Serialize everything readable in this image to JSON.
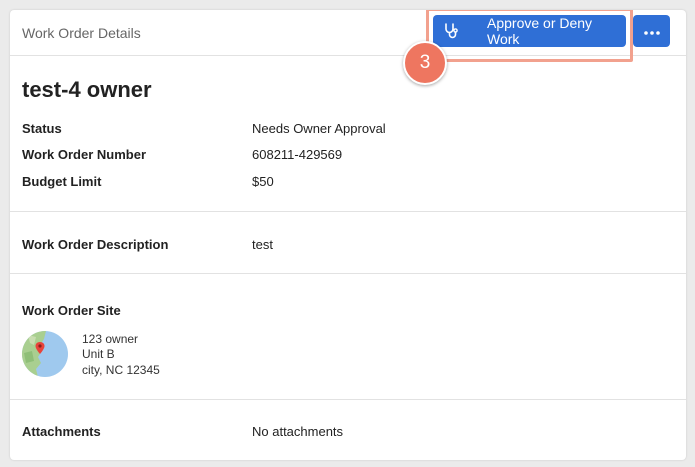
{
  "header": {
    "title": "Work Order Details",
    "approve_label": "Approve or Deny Work",
    "approve_icon": "stethoscope-icon",
    "more_icon": "ellipsis-icon",
    "accent_color": "#2f6fd6"
  },
  "annotation": {
    "step_number": "3",
    "badge_color": "#ee7660",
    "highlight_color": "#f2a18e"
  },
  "details": {
    "title": "test-4 owner",
    "status": {
      "label": "Status",
      "value": "Needs Owner Approval"
    },
    "number": {
      "label": "Work Order Number",
      "value": "608211-429569"
    },
    "budget": {
      "label": "Budget Limit",
      "value": "$50"
    }
  },
  "description": {
    "label": "Work Order Description",
    "value": "test"
  },
  "site": {
    "label": "Work Order Site",
    "map_icon": "map-pin-icon",
    "address": [
      "123 owner",
      "Unit B",
      "city, NC 12345"
    ]
  },
  "attachments": {
    "label": "Attachments",
    "value": "No attachments"
  }
}
